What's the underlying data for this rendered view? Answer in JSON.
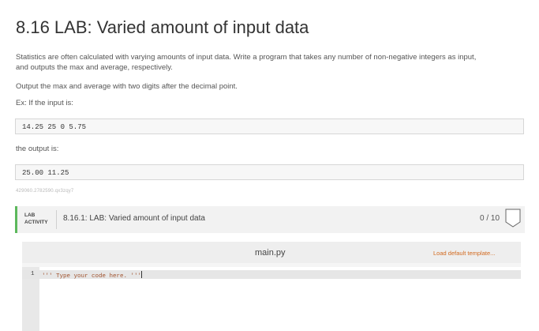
{
  "page": {
    "title": "8.16 LAB: Varied amount of input data"
  },
  "instructions": {
    "paragraph1_line1": "Statistics are often calculated with varying amounts of input data. Write a program that takes any number of non-negative integers as input,",
    "paragraph1_line2": "and outputs the max and average, respectively.",
    "paragraph2": "Output the max and average with two digits after the decimal point.",
    "example_intro": "Ex: If the input is:",
    "example_input": "14.25 25 0 5.75",
    "output_intro": "the output is:",
    "example_output": "25.00 11.25",
    "tracking_id": "429060.2782590.qx3zqy7"
  },
  "activity": {
    "type_label_line1": "LAB",
    "type_label_line2": "ACTIVITY",
    "title": "8.16.1: LAB: Varied amount of input data",
    "score": "0 / 10",
    "accent_color": "#5cb85c"
  },
  "editor": {
    "filename": "main.py",
    "load_template_label": "Load default template...",
    "lines": [
      {
        "number": "1",
        "code": "''' Type your code here. '''"
      }
    ]
  }
}
